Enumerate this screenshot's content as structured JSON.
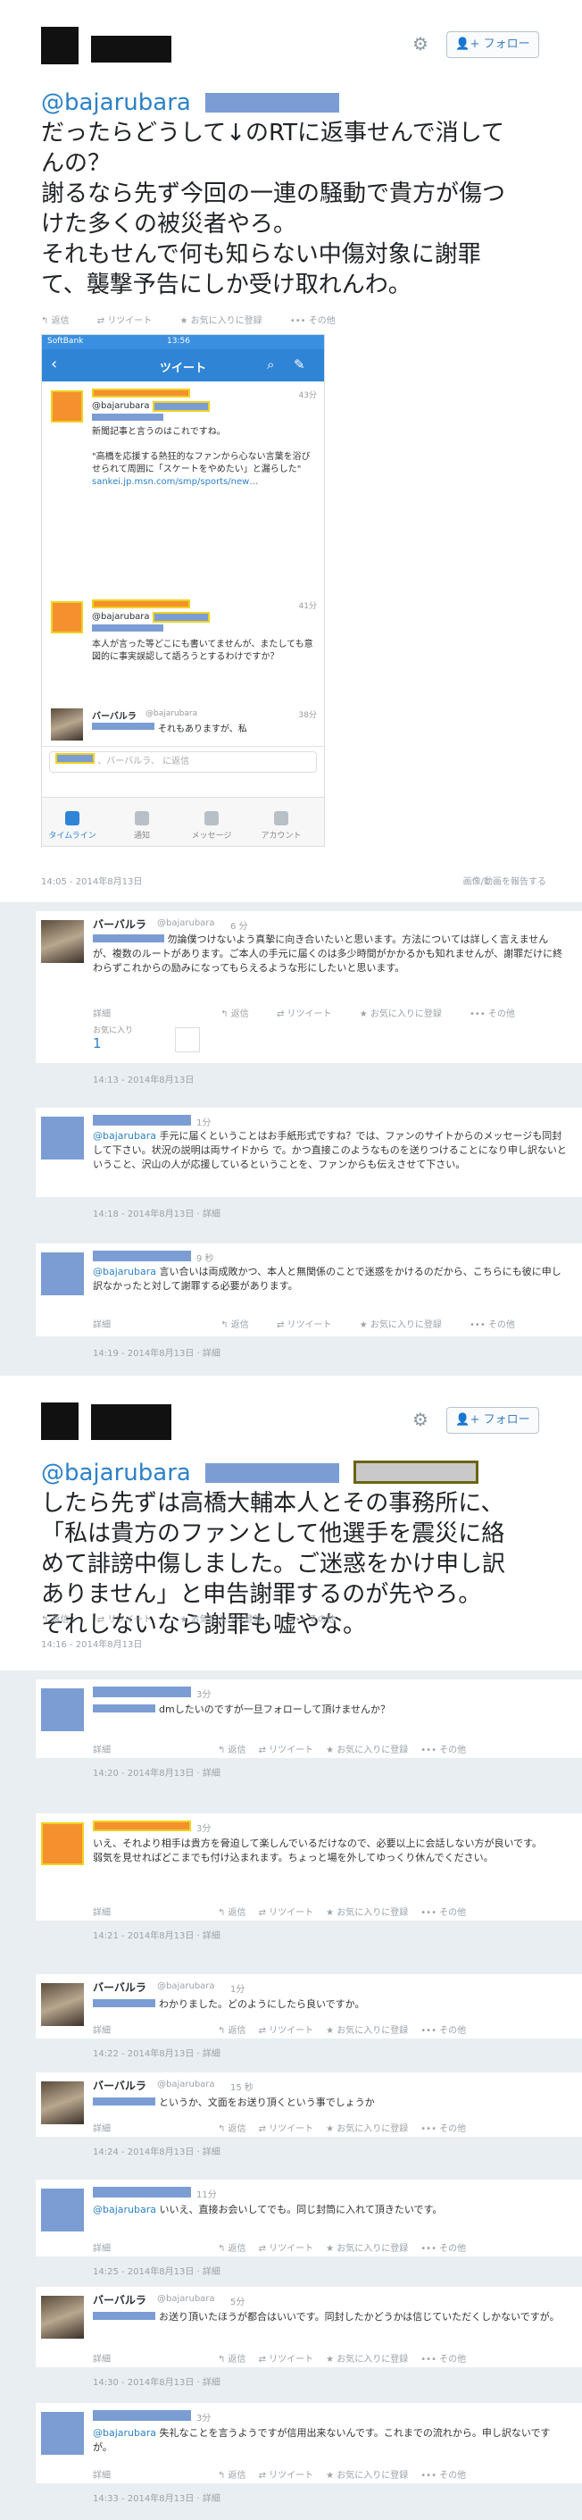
{
  "common": {
    "follow": "フォロー",
    "actions": [
      "返信",
      "リツイート",
      "お気に入りに登録",
      "その他"
    ],
    "report": "画像/動画を報告する",
    "detail": "詳細",
    "colors": {
      "link": "#2c81c9",
      "bg": "#e9eef2",
      "redact_blue": "#7b9dd4",
      "redact_orange": "#f5902f"
    }
  },
  "tweet1": {
    "handle": "@bajarubara",
    "lines": [
      "だったらどうして↓のRTに返事せんで消して",
      "んの？",
      "謝るなら先ず今回の一連の騒動で貴方が傷つ",
      "けた多くの被災者やろ。",
      "それもせんで何も知らない中傷対象に謝罪",
      "て、襲撃予告にしか受け取れんわ。"
    ],
    "timestamp": "14:05 - 2014年8月13日",
    "screenshot": {
      "status_left": "SoftBank",
      "status_time": "13:56",
      "nav_title": "ツイート",
      "tweets": [
        {
          "handle": "@bajarubara",
          "time": "43分",
          "text": "新聞記事と言うのはこれですね。",
          "quote": "\"高橋を応援する熱狂的なファンから心ない言葉を浴びせられて周囲に「スケートをやめたい」と漏らした\"",
          "link": "sankei.jp.msn.com/smp/sports/new…"
        },
        {
          "handle": "@bajarubara",
          "time": "41分",
          "text": "本人が言った等どこにも書いてませんが、またしても意図的に事実誤認して語ろうとするわけですか？"
        },
        {
          "name": "バーバルラ",
          "handle": "@bajarubara",
          "time": "38分",
          "text": "それもありますが、私"
        }
      ],
      "reply_placeholder": "、バーバルラ、 に返信",
      "tabs": [
        "タイムライン",
        "通知",
        "メッセージ",
        "アカウント"
      ]
    }
  },
  "reply1": {
    "name": "バーバルラ",
    "handle": "@bajarubara",
    "time": "6 分",
    "text": "勿論僕つけないよう真摯に向き合いたいと思います。方法については詳しく言えませんが、複数のルートがあります。ご本人の手元に届くのは多少時間がかかるかも知れませんが、謝罪だけに終わらずこれからの励みになってもらえるような形にしたいと思います。",
    "fav_label": "お気に入り",
    "fav_count": "1",
    "timestamp": "14:13 - 2014年8月13日"
  },
  "reply2": {
    "time": "1分",
    "handle": "@bajarubara",
    "text": "手元に届くということはお手紙形式ですね？では、ファンのサイトからのメッセージも同封して下さい。状況の説明は両サイドから で。かつ直接このようなものを送りつけることになり申し訳ないということ、沢山の人が応援しているということを、ファンからも伝えさせて下さい。",
    "timestamp": "14:18 - 2014年8月13日 · 詳細"
  },
  "reply3": {
    "time": "9 秒",
    "handle": "@bajarubara",
    "text": "言い合いは両成敗かつ、本人と無関係のことで迷惑をかけるのだから、こちらにも彼に申し訳なかったと対して謝罪する必要があります。",
    "timestamp": "14:19 - 2014年8月13日 · 詳細"
  },
  "tweet2": {
    "handle": "@bajarubara",
    "lines": [
      "したら先ずは高橋大輔本人とその事務所に、",
      "「私は貴方のファンとして他選手を震災に絡",
      "めて誹謗中傷しました。ご迷惑をかけ申し訳",
      "ありません」と申告謝罪するのが先やろ。",
      "それしないなら謝罪も嘘やな。"
    ],
    "timestamp": "14:16 - 2014年8月13日"
  },
  "replies": [
    {
      "kind": "blue",
      "time": "3分",
      "text": "dmしたいのですが一旦フォローして頂けませんか？",
      "timestamp": "14:20 - 2014年8月13日 · 詳細"
    },
    {
      "kind": "orange",
      "time": "3分",
      "text": "いえ、それより相手は貴方を脅迫して楽しんでいるだけなので、必要以上に会話しない方が良いです。\n弱気を見せればどこまでも付け込まれます。ちょっと場を外してゆっくり休んでください。",
      "timestamp": "14:21 - 2014年8月13日 · 詳細"
    },
    {
      "kind": "photo",
      "name": "バーバルラ",
      "handle": "@bajarubara",
      "time": "1分",
      "text": "わかりました。どのようにしたら良いですか。",
      "timestamp": "14:22 - 2014年8月13日 · 詳細"
    },
    {
      "kind": "photo",
      "name": "バーバルラ",
      "handle": "@bajarubara",
      "time": "15 秒",
      "text": "というか、文面をお送り頂くという事でしょうか",
      "timestamp": "14:24 - 2014年8月13日 · 詳細"
    },
    {
      "kind": "blue",
      "time": "11分",
      "handle": "@bajarubara",
      "text": "いいえ、直接お会いしてでも。同じ封筒に入れて頂きたいです。",
      "timestamp": "14:25 - 2014年8月13日 · 詳細"
    },
    {
      "kind": "photo",
      "name": "バーバルラ",
      "handle": "@bajarubara",
      "time": "5分",
      "text": "お送り頂いたほうが都合はいいです。同封したかどうかは信じていただくしかないですが。",
      "timestamp": "14:30 - 2014年8月13日 · 詳細"
    },
    {
      "kind": "blue",
      "time": "3分",
      "handle": "@bajarubara",
      "text": "失礼なことを言うようですが信用出来ないんです。これまでの流れから。申し訳ないですが。",
      "timestamp": "14:33 - 2014年8月13日 · 詳細"
    }
  ]
}
